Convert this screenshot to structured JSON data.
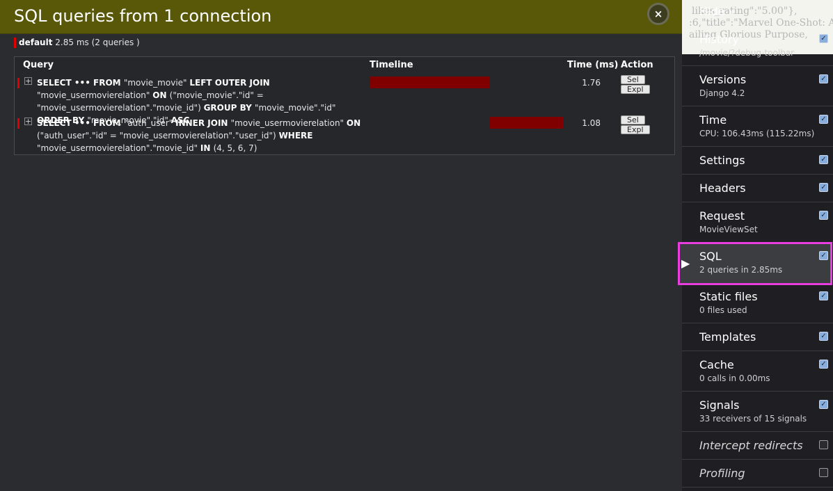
{
  "panel": {
    "title": "SQL queries from 1 connection",
    "close_label": "×",
    "connection": {
      "alias": "default",
      "summary": "2.85 ms (2 queries )"
    },
    "columns": {
      "query": "Query",
      "timeline": "Timeline",
      "time": "Time (ms)",
      "action": "Action"
    },
    "queries": [
      {
        "toggle": "+",
        "sql": [
          {
            "b": true,
            "t": "SELECT ••• FROM "
          },
          {
            "b": false,
            "t": "\"movie_movie\" "
          },
          {
            "b": true,
            "t": "LEFT OUTER JOIN "
          },
          {
            "b": false,
            "t": "\"movie_usermovierelation\" "
          },
          {
            "b": true,
            "t": "ON "
          },
          {
            "b": false,
            "t": "(\"movie_movie\".\"id\" = \"movie_usermovierelation\".\"movie_id\") "
          },
          {
            "b": true,
            "t": "GROUP BY "
          },
          {
            "b": false,
            "t": "\"movie_movie\".\"id\" "
          },
          {
            "b": true,
            "t": "ORDER BY "
          },
          {
            "b": false,
            "t": "\"movie_movie\".\"id\" "
          },
          {
            "b": true,
            "t": "ASC"
          }
        ],
        "time": "1.76",
        "timeline_start": 0.0,
        "timeline_width": 0.6175,
        "sel_label": "Sel",
        "expl_label": "Expl"
      },
      {
        "toggle": "+",
        "sql": [
          {
            "b": true,
            "t": "SELECT ••• FROM "
          },
          {
            "b": false,
            "t": "\"auth_user\" "
          },
          {
            "b": true,
            "t": "INNER JOIN "
          },
          {
            "b": false,
            "t": "\"movie_usermovierelation\" "
          },
          {
            "b": true,
            "t": "ON "
          },
          {
            "b": false,
            "t": "(\"auth_user\".\"id\" = \"movie_usermovierelation\".\"user_id\") "
          },
          {
            "b": true,
            "t": "WHERE "
          },
          {
            "b": false,
            "t": "\"movie_usermovierelation\".\"movie_id\" "
          },
          {
            "b": true,
            "t": "IN "
          },
          {
            "b": false,
            "t": "(4, 5, 6, 7)"
          }
        ],
        "time": "1.08",
        "timeline_start": 0.6175,
        "timeline_width": 0.3789,
        "sel_label": "Sel",
        "expl_label": "Expl"
      }
    ]
  },
  "background_page": {
    "lines": [
      "likes_rating\":\"5.00\"},",
      ":6,\"title\":\"Marvel One-Shot: All",
      "ailing Glorious Purpose,"
    ]
  },
  "toolbar": {
    "hide_label": "Hide »",
    "active_marker": "▶",
    "items": [
      {
        "id": "history",
        "title": "History",
        "sub": "/movie/?debug-toolbar",
        "checked": true
      },
      {
        "id": "versions",
        "title": "Versions",
        "sub": "Django 4.2",
        "checked": true
      },
      {
        "id": "time",
        "title": "Time",
        "sub": "CPU: 106.43ms (115.22ms)",
        "checked": true
      },
      {
        "id": "settings",
        "title": "Settings",
        "sub": "",
        "checked": true
      },
      {
        "id": "headers",
        "title": "Headers",
        "sub": "",
        "checked": true
      },
      {
        "id": "request",
        "title": "Request",
        "sub": "MovieViewSet",
        "checked": true
      },
      {
        "id": "sql",
        "title": "SQL",
        "sub": "2 queries in 2.85ms",
        "checked": true,
        "active": true
      },
      {
        "id": "static-files",
        "title": "Static files",
        "sub": "0 files used",
        "checked": true
      },
      {
        "id": "templates",
        "title": "Templates",
        "sub": "",
        "checked": true
      },
      {
        "id": "cache",
        "title": "Cache",
        "sub": "0 calls in 0.00ms",
        "checked": true
      },
      {
        "id": "signals",
        "title": "Signals",
        "sub": "33 receivers of 15 signals",
        "checked": true
      },
      {
        "id": "intercept-redirects",
        "title": "Intercept redirects",
        "sub": "",
        "checked": false,
        "italic": true
      },
      {
        "id": "profiling",
        "title": "Profiling",
        "sub": "",
        "checked": false,
        "italic": true
      }
    ]
  },
  "colors": {
    "header": "#595808",
    "accent_red": "#e00000",
    "timeline_bar": "#800000",
    "highlight": "#e83ee0",
    "checkbox": "#8aaedb"
  },
  "icons": {
    "close": "close-icon",
    "toggle": "expand-icon",
    "active": "play-arrow-icon"
  }
}
